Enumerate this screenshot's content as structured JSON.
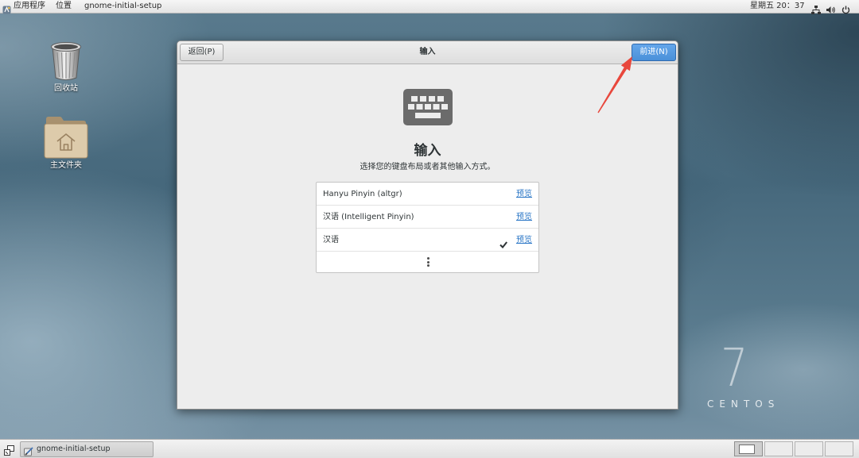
{
  "top_bar": {
    "applications_label": "应用程序",
    "places_label": "位置",
    "active_app_label": "gnome-initial-setup",
    "clock": "星期五 20：37"
  },
  "desktop": {
    "trash_label": "回收站",
    "home_label": "主文件夹"
  },
  "window": {
    "back_label": "返回(P)",
    "title": "输入",
    "forward_label": "前进(N)",
    "heading": "输入",
    "subtitle": "选择您的键盘布局或者其他输入方式。",
    "input_sources": [
      {
        "name": "Hanyu Pinyin (altgr)",
        "preview_label": "预览",
        "selected": false
      },
      {
        "name": "汉语 (Intelligent Pinyin)",
        "preview_label": "预览",
        "selected": false
      },
      {
        "name": "汉语",
        "preview_label": "预览",
        "selected": true
      }
    ]
  },
  "watermark": {
    "numeral": "7",
    "brand": "CENTOS"
  },
  "taskbar": {
    "task_label": "gnome-initial-setup",
    "workspaces": [
      {
        "active": true
      },
      {
        "active": false
      },
      {
        "active": false
      },
      {
        "active": false
      }
    ]
  },
  "icons": {
    "top_bar": [
      "applications-icon",
      "network-icon",
      "volume-icon",
      "power-icon"
    ],
    "desktop": [
      "trash-icon",
      "home-folder-icon"
    ],
    "window": [
      "keyboard-icon",
      "checkmark-icon",
      "more-icon"
    ],
    "taskbar": [
      "show-desktop-icon",
      "app-icon"
    ]
  },
  "colors": {
    "accent": "#4a90d9",
    "link": "#2a76c6",
    "annotation_arrow": "#e8473c"
  }
}
